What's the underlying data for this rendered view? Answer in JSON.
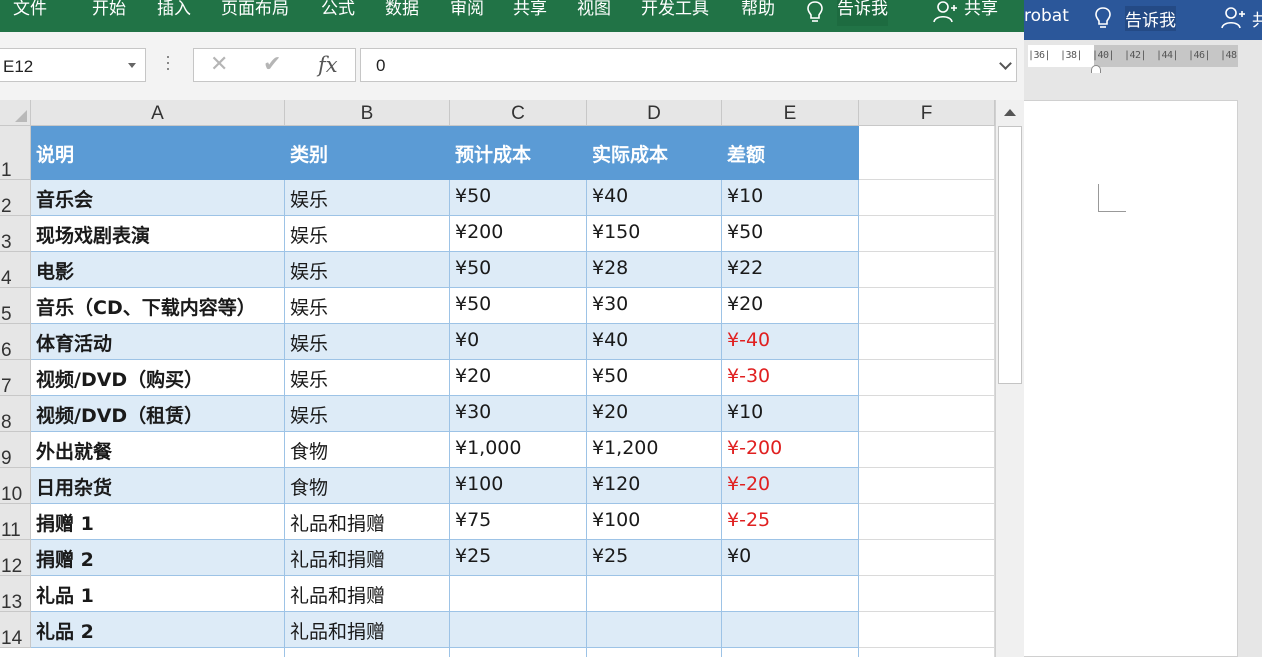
{
  "excel": {
    "tabs": [
      "文件",
      "开始",
      "插入",
      "页面布局",
      "公式",
      "数据",
      "审阅",
      "共享",
      "视图",
      "开发工具",
      "帮助"
    ],
    "tell_me": "告诉我",
    "share": "共享",
    "name_box": "E12",
    "formula_value": "0",
    "columns": [
      "A",
      "B",
      "C",
      "D",
      "E",
      "F"
    ],
    "rows": [
      "1",
      "2",
      "3",
      "4",
      "5",
      "6",
      "7",
      "8",
      "9",
      "10",
      "11",
      "12",
      "13",
      "14"
    ],
    "table": {
      "headers": [
        "说明",
        "类别",
        "预计成本",
        "实际成本",
        "差额"
      ],
      "rows": [
        [
          "音乐会",
          "娱乐",
          "¥50",
          "¥40",
          "¥10"
        ],
        [
          "现场戏剧表演",
          "娱乐",
          "¥200",
          "¥150",
          "¥50"
        ],
        [
          "电影",
          "娱乐",
          "¥50",
          "¥28",
          "¥22"
        ],
        [
          "音乐（CD、下载内容等）",
          "娱乐",
          "¥50",
          "¥30",
          "¥20"
        ],
        [
          "体育活动",
          "娱乐",
          "¥0",
          "¥40",
          "¥-40"
        ],
        [
          "视频/DVD（购买）",
          "娱乐",
          "¥20",
          "¥50",
          "¥-30"
        ],
        [
          "视频/DVD（租赁）",
          "娱乐",
          "¥30",
          "¥20",
          "¥10"
        ],
        [
          "外出就餐",
          "食物",
          "¥1,000",
          "¥1,200",
          "¥-200"
        ],
        [
          "日用杂货",
          "食物",
          "¥100",
          "¥120",
          "¥-20"
        ],
        [
          "捐赠 1",
          "礼品和捐赠",
          "¥75",
          "¥100",
          "¥-25"
        ],
        [
          "捐赠 2",
          "礼品和捐赠",
          "¥25",
          "¥25",
          "¥0"
        ],
        [
          "礼品 1",
          "礼品和捐赠",
          "",
          "",
          ""
        ],
        [
          "礼品 2",
          "礼品和捐赠",
          "",
          "",
          ""
        ]
      ]
    },
    "colors": {
      "ribbon": "#217346",
      "header_fill": "#5b9bd5",
      "band_fill": "#ddebf7",
      "negative": "#e02020"
    }
  },
  "word": {
    "tab_partial": "robat",
    "tell_me": "告诉我",
    "share_partial": "共",
    "ruler_marks": [
      "|36|",
      "|38|",
      "|40|",
      "|42|",
      "|44|",
      "|46|",
      "|48"
    ],
    "colors": {
      "ribbon": "#2b579a"
    }
  }
}
